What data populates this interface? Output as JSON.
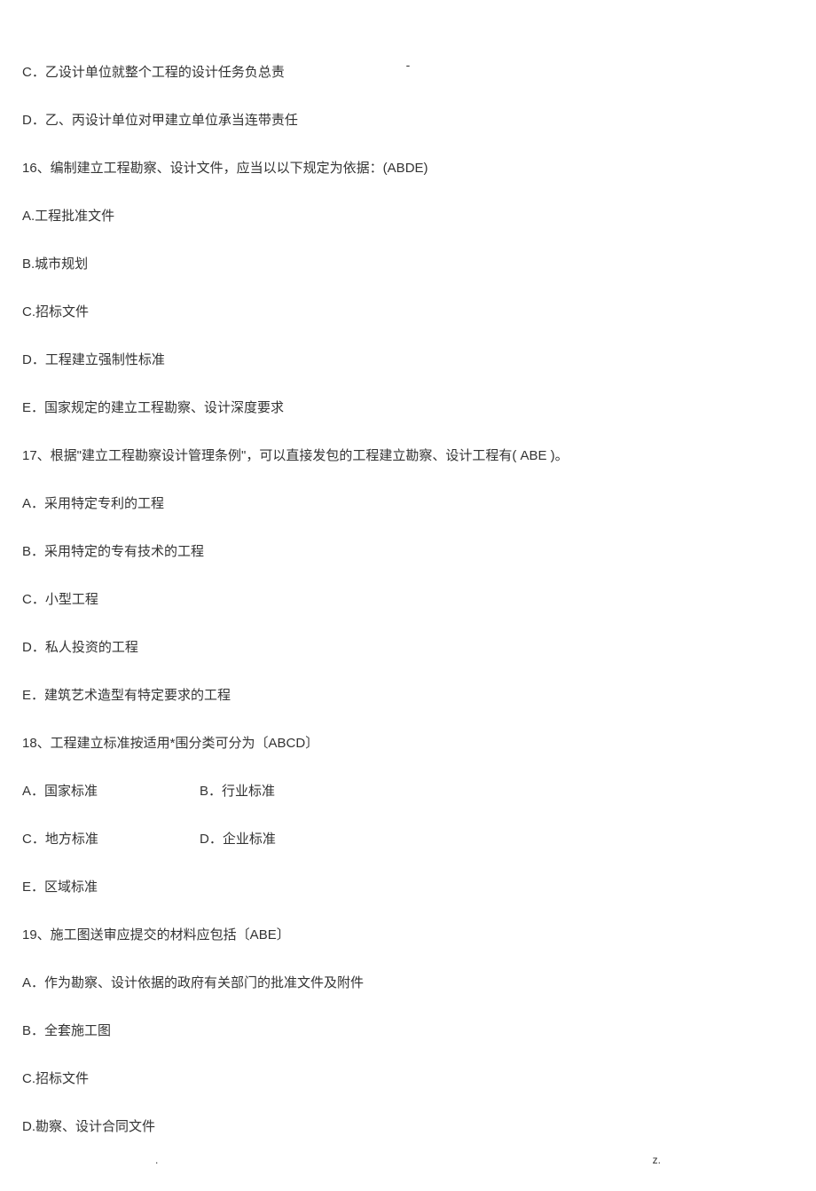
{
  "header_mark": "-",
  "q15_partial": {
    "optC": "C．乙设计单位就整个工程的设计任务负总责",
    "optD": "D．乙、丙设计单位对甲建立单位承当连带责任"
  },
  "q16": {
    "stem": "16、编制建立工程勘察、设计文件，应当以以下规定为依据：(ABDE)",
    "optA": "A.工程批准文件",
    "optB": "B.城市规划",
    "optC": "C.招标文件",
    "optD": "D．工程建立强制性标准",
    "optE": "E．国家规定的建立工程勘察、设计深度要求"
  },
  "q17": {
    "stem": "17、根据\"建立工程勘察设计管理条例\"，可以直接发包的工程建立勘察、设计工程有( ABE )。",
    "optA": "A．采用特定专利的工程",
    "optB": "B．采用特定的专有技术的工程",
    "optC": "C．小型工程",
    "optD": "D．私人投资的工程",
    "optE": "E．建筑艺术造型有特定要求的工程"
  },
  "q18": {
    "stem": "18、工程建立标准按适用*围分类可分为〔ABCD〕",
    "optA": "A．国家标准",
    "optB": "B．行业标准",
    "optC": "C．地方标准",
    "optD": "D．企业标准",
    "optE": "E．区域标准"
  },
  "q19": {
    "stem": "19、施工图送审应提交的材料应包括〔ABE〕",
    "optA": "A．作为勘察、设计依据的政府有关部门的批准文件及附件",
    "optB": "B．全套施工图",
    "optC": "C.招标文件",
    "optD": "D.勘察、设计合同文件"
  },
  "footer": {
    "left": ".",
    "right": "z."
  }
}
